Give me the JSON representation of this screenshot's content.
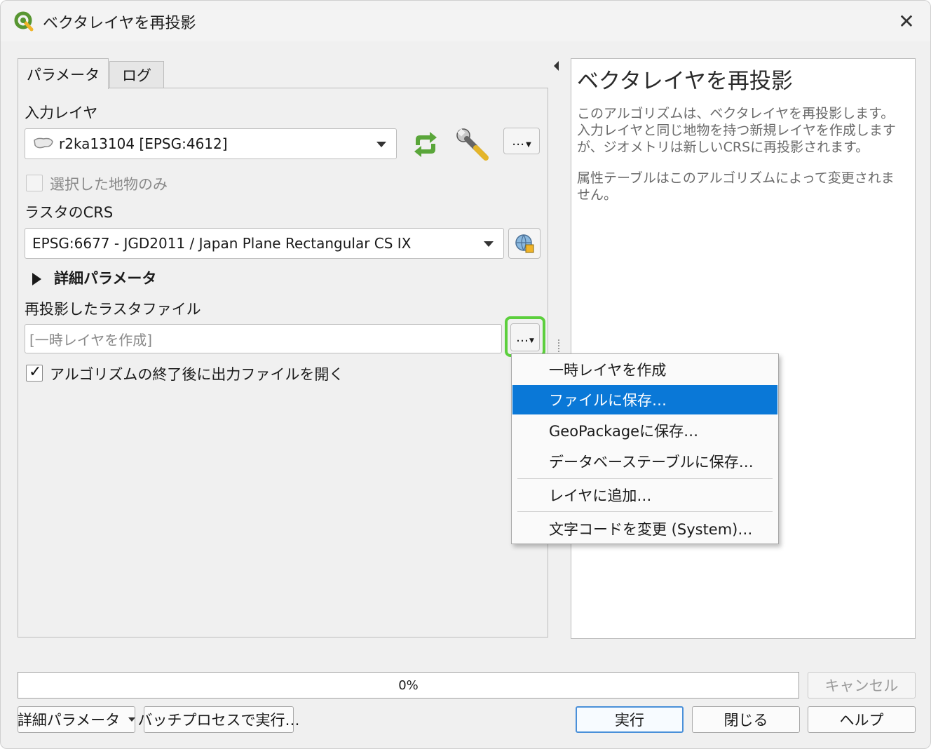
{
  "window": {
    "title": "ベクタレイヤを再投影"
  },
  "tabs": [
    {
      "label": "パラメータ"
    },
    {
      "label": "ログ"
    }
  ],
  "params": {
    "input_layer_label": "入力レイヤ",
    "input_layer_value": "r2ka13104 [EPSG:4612]",
    "selected_only_label": "選択した地物のみ",
    "selected_only_checked": false,
    "raster_crs_label": "ラスタのCRS",
    "raster_crs_value": "EPSG:6677 - JGD2011 / Japan Plane Rectangular CS IX",
    "advanced_params_label": "詳細パラメータ",
    "output_label": "再投影したラスタファイル",
    "output_placeholder": "[一時レイヤを作成]",
    "open_after_label": "アルゴリズムの終了後に出力ファイルを開く",
    "open_after_checked": true,
    "more_button": "…",
    "browse_button": "…"
  },
  "menu": {
    "items": [
      {
        "label": "一時レイヤを作成"
      },
      {
        "label": "ファイルに保存…"
      },
      {
        "label": "GeoPackageに保存…"
      },
      {
        "label": "データベーステーブルに保存…"
      },
      {
        "label": "レイヤに追加…"
      },
      {
        "label": "文字コードを変更 (System)…"
      }
    ],
    "selected_index": 1
  },
  "help": {
    "title": "ベクタレイヤを再投影",
    "paragraph1": "このアルゴリズムは、ベクタレイヤを再投影します。入力レイヤと同じ地物を持つ新規レイヤを作成しますが、ジオメトリは新しいCRSに再投影されます。",
    "paragraph2": "属性テーブルはこのアルゴリズムによって変更されません。"
  },
  "footer": {
    "progress_text": "0%",
    "progress_value": 0,
    "cancel": "キャンセル",
    "advanced": "詳細パラメータ",
    "batch": "バッチプロセスで実行…",
    "run": "実行",
    "close": "閉じる",
    "help": "ヘルプ"
  },
  "colors": {
    "menu_selected": "#0a78d7",
    "highlight_ring": "#5ccf3d",
    "qgis_green": "#589632"
  }
}
